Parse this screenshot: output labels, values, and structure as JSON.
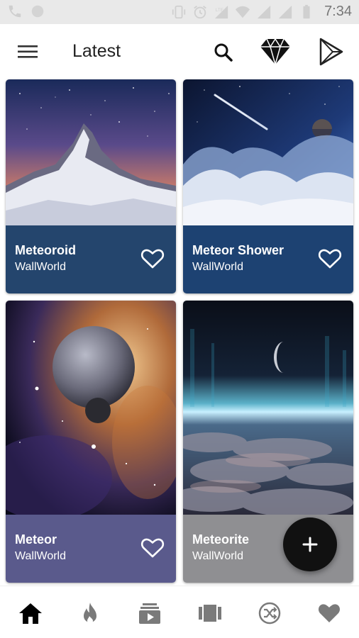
{
  "status_bar": {
    "time": "7:34",
    "left_icons": [
      "phone-icon",
      "notification-dot-icon"
    ],
    "right_icons": [
      "vibrate-icon",
      "alarm-icon",
      "lte-icon",
      "wifi-icon",
      "signal-icon",
      "signal-icon",
      "battery-icon"
    ]
  },
  "app_bar": {
    "title": "Latest",
    "icons": [
      "menu-icon",
      "search-icon",
      "diamond-icon",
      "play-store-icon"
    ]
  },
  "wallpapers": [
    {
      "title": "Meteoroid",
      "subtitle": "WallWorld",
      "info_color": "#24456d",
      "image": "snowy-mountain-peak-under-starry-sky"
    },
    {
      "title": "Meteor Shower",
      "subtitle": "WallWorld",
      "info_color": "#1d4272",
      "image": "shooting-star-over-clouds-and-planet"
    },
    {
      "title": "Meteor",
      "subtitle": "WallWorld",
      "info_color": "#5a5a8c",
      "image": "planets-in-nebula"
    },
    {
      "title": "Meteorite",
      "subtitle": "WallWorld",
      "info_color": "#8f8f92",
      "image": "moon-over-cloud-sea-with-aurora"
    }
  ],
  "fab": {
    "icon": "plus-icon"
  },
  "bottom_nav": {
    "items": [
      "home-icon",
      "fire-icon",
      "video-library-icon",
      "carousel-icon",
      "shuffle-icon",
      "heart-icon"
    ],
    "active_index": 0
  },
  "colors": {
    "accent": "#111111",
    "status_bar_bg": "#e9e9e9",
    "inactive_icon": "#7a7a7a"
  }
}
